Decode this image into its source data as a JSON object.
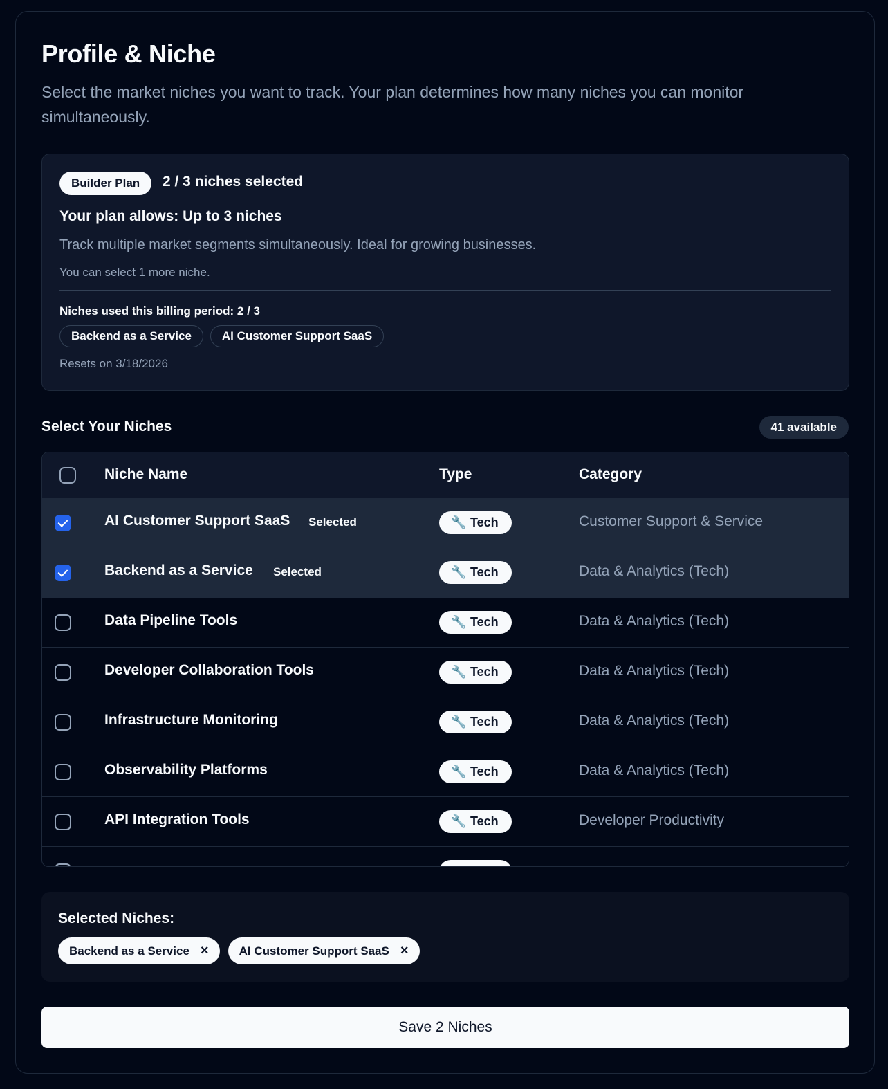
{
  "header": {
    "title": "Profile & Niche",
    "subtitle": "Select the market niches you want to track. Your plan determines how many niches you can monitor simultaneously."
  },
  "plan": {
    "badge": "Builder Plan",
    "count": "2 / 3 niches selected",
    "allows": "Your plan allows: Up to 3 niches",
    "description": "Track multiple market segments simultaneously. Ideal for growing businesses.",
    "remaining": "You can select 1 more niche.",
    "used_label": "Niches used this billing period: 2 / 3",
    "used_niches": [
      "Backend as a Service",
      "AI Customer Support SaaS"
    ],
    "resets": "Resets on 3/18/2026"
  },
  "niches": {
    "section_title": "Select Your Niches",
    "available": "41 available",
    "columns": {
      "name": "Niche Name",
      "type": "Type",
      "category": "Category"
    },
    "rows": [
      {
        "name": "AI Customer Support SaaS",
        "selected_label": "Selected",
        "type_icon": "wrench-icon",
        "type": "Tech",
        "category": "Customer Support & Service"
      },
      {
        "name": "Backend as a Service",
        "selected_label": "Selected",
        "type_icon": "wrench-icon",
        "type": "Tech",
        "category": "Data & Analytics (Tech)"
      },
      {
        "name": "Data Pipeline Tools",
        "type_icon": "wrench-icon",
        "type": "Tech",
        "category": "Data & Analytics (Tech)"
      },
      {
        "name": "Developer Collaboration Tools",
        "type_icon": "wrench-icon",
        "type": "Tech",
        "category": "Data & Analytics (Tech)"
      },
      {
        "name": "Infrastructure Monitoring",
        "type_icon": "wrench-icon",
        "type": "Tech",
        "category": "Data & Analytics (Tech)"
      },
      {
        "name": "Observability Platforms",
        "type_icon": "wrench-icon",
        "type": "Tech",
        "category": "Data & Analytics (Tech)"
      },
      {
        "name": "API Integration Tools",
        "type_icon": "wrench-icon",
        "type": "Tech",
        "category": "Developer Productivity"
      }
    ]
  },
  "selected": {
    "label": "Selected Niches:",
    "chips": [
      "Backend as a Service",
      "AI Customer Support SaaS"
    ],
    "remove_symbol": "×"
  },
  "save_button": "Save 2 Niches",
  "colors": {
    "background": "#020817",
    "surface": "#0f172a",
    "selected_row": "#1e293b",
    "checkbox_accent": "#2563eb",
    "muted_text": "#94a3b8"
  }
}
